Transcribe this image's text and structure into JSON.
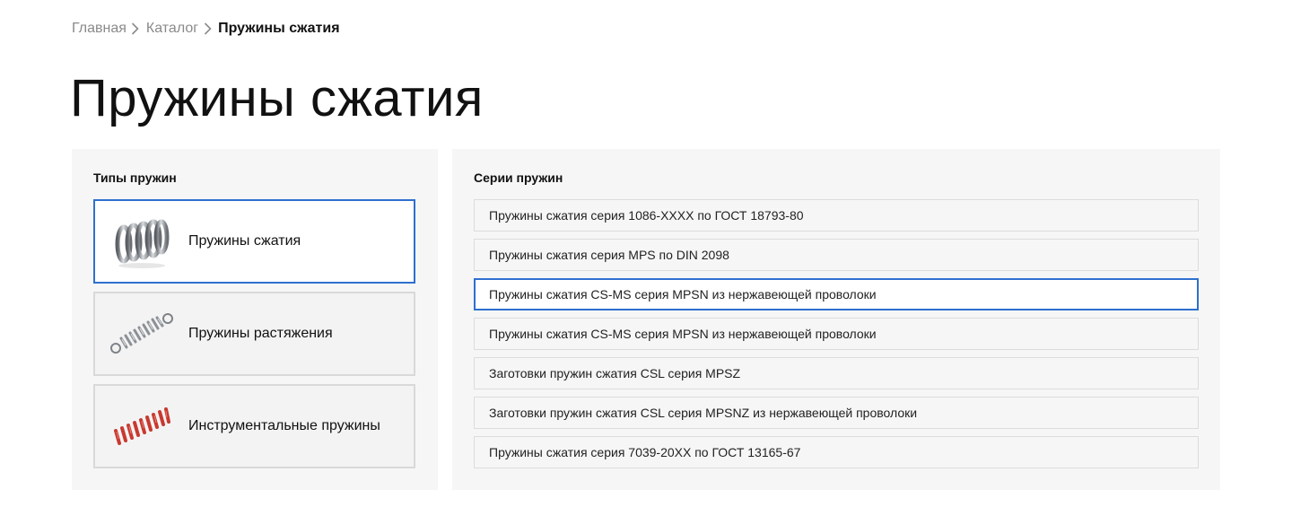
{
  "breadcrumb": {
    "items": [
      "Главная",
      "Каталог"
    ],
    "current": "Пружины сжатия"
  },
  "page": {
    "title": "Пружины сжатия"
  },
  "types": {
    "heading": "Типы пружин",
    "items": [
      {
        "label": "Пружины сжатия",
        "icon": "compression-spring-icon",
        "active": true
      },
      {
        "label": "Пружины растяжения",
        "icon": "extension-spring-icon",
        "active": false
      },
      {
        "label": "Инструментальные пружины",
        "icon": "die-spring-icon",
        "active": false
      }
    ]
  },
  "series": {
    "heading": "Серии пружин",
    "items": [
      {
        "label": "Пружины сжатия серия 1086-XXXX по ГОСТ 18793-80",
        "active": false
      },
      {
        "label": "Пружины сжатия серия MPS по DIN 2098",
        "active": false
      },
      {
        "label": "Пружины сжатия CS-MS серия MPSN из нержавеющей проволоки",
        "active": true
      },
      {
        "label": "Пружины сжатия CS-MS серия MPSN из нержавеющей проволоки",
        "active": false
      },
      {
        "label": "Заготовки пружин сжатия CSL серия MPSZ",
        "active": false
      },
      {
        "label": "Заготовки пружин сжатия CSL серия MPSNZ из нержавеющей проволоки",
        "active": false
      },
      {
        "label": "Пружины сжатия серия 7039-20XX по ГОСТ 13165-67",
        "active": false
      }
    ]
  },
  "colors": {
    "accent": "#2e6fcf",
    "panel": "#f6f6f6",
    "die_spring": "#c8392f",
    "steel": "#8c9096"
  }
}
